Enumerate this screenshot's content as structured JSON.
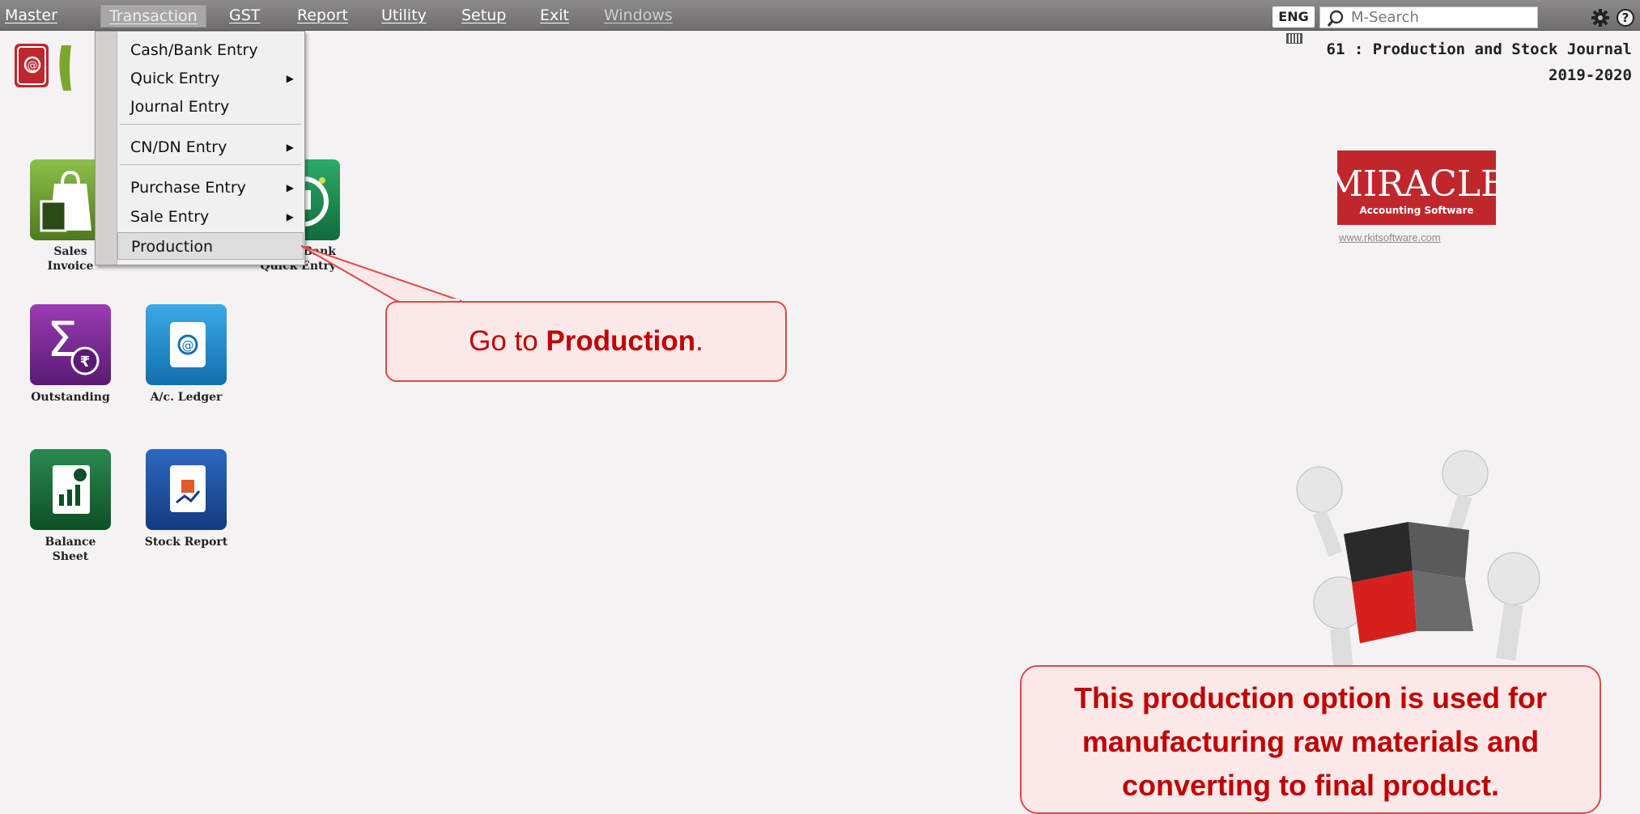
{
  "menubar": {
    "items": [
      {
        "label": "Master"
      },
      {
        "label": "Transaction"
      },
      {
        "label": "GST"
      },
      {
        "label": "Report"
      },
      {
        "label": "Utility"
      },
      {
        "label": "Setup"
      },
      {
        "label": "Exit"
      },
      {
        "label": "Windows"
      }
    ],
    "language": "ENG",
    "search_placeholder": "M-Search"
  },
  "header": {
    "title": "61 : Production and Stock Journal",
    "year": "2019-2020"
  },
  "dropdown": {
    "items": [
      {
        "label": "Cash/Bank Entry",
        "submenu": false
      },
      {
        "label": "Quick Entry",
        "submenu": true
      },
      {
        "label": "Journal Entry",
        "submenu": false
      },
      {
        "label": "CN/DN Entry",
        "submenu": true
      },
      {
        "label": "Purchase Entry",
        "submenu": true
      },
      {
        "label": "Sale Entry",
        "submenu": true
      },
      {
        "label": "Production",
        "submenu": false,
        "highlighted": true
      }
    ]
  },
  "tiles": [
    {
      "label_line1": "Sales",
      "label_line2": "Invoice",
      "icon": "sales-invoice-icon",
      "color": "#6b9a2a"
    },
    {
      "label_line1": "Bank",
      "label_line2": "Quick Entry",
      "icon": "bank-quick-entry-icon",
      "color": "#1e8a52"
    },
    {
      "label_line1": "Outstanding",
      "label_line2": "",
      "icon": "outstanding-icon",
      "color": "#6b2a8a"
    },
    {
      "label_line1": "A/c. Ledger",
      "label_line2": "",
      "icon": "ledger-icon",
      "color": "#1b8fd0"
    },
    {
      "label_line1": "Balance",
      "label_line2": "Sheet",
      "icon": "balance-sheet-icon",
      "color": "#1e6b3a"
    },
    {
      "label_line1": "Stock Report",
      "label_line2": "",
      "icon": "stock-report-icon",
      "color": "#1d4f9a"
    }
  ],
  "brand": {
    "name": "MIRACLE",
    "tagline": "Accounting Software",
    "url": "www.rkitsoftware.com"
  },
  "callout1": {
    "prefix": "Go to ",
    "bold": "Production",
    "suffix": "."
  },
  "callout2": {
    "line1": "This production option is used for",
    "line2": "manufacturing raw materials and",
    "line3": "converting to final product."
  },
  "colors": {
    "menubar": "#7a7878",
    "callout_text": "#c00000",
    "callout_border": "#e0494b",
    "brand_red": "#c0262c"
  }
}
